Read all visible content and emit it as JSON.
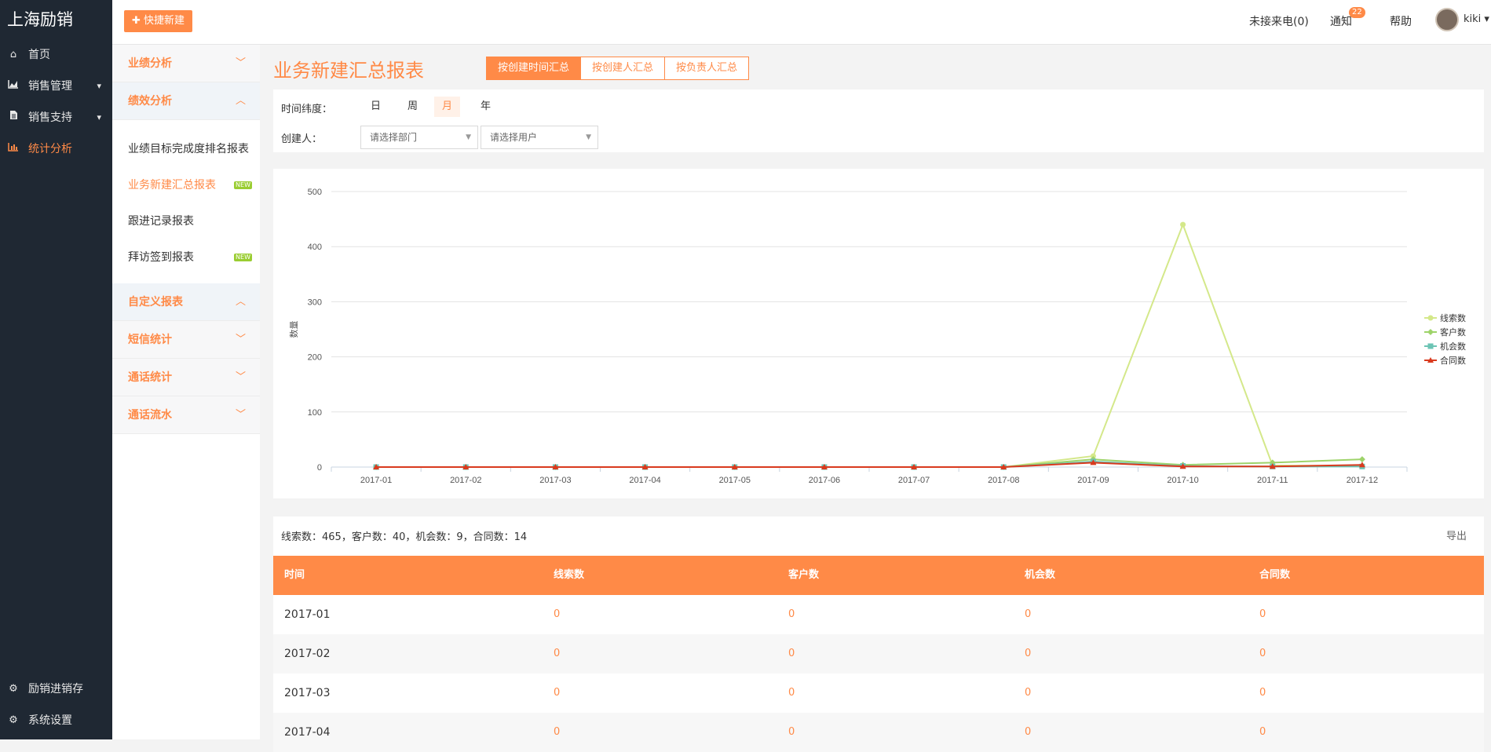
{
  "app": {
    "brand": "上海励销"
  },
  "topbar": {
    "quick_new": "✚ 快捷新建",
    "missed_calls": "未接来电(0)",
    "notice_label": "通知",
    "notice_count": "22",
    "help": "帮助",
    "user": "kiki ▾"
  },
  "left_nav": {
    "items": [
      {
        "icon": "home-icon",
        "label": "首页"
      },
      {
        "icon": "area-chart-icon",
        "label": "销售管理"
      },
      {
        "icon": "file-icon",
        "label": "销售支持"
      },
      {
        "icon": "bar-chart-icon",
        "label": "统计分析"
      }
    ],
    "bottom": [
      {
        "icon": "gear-icon",
        "label": "励销进销存"
      },
      {
        "icon": "gear-icon",
        "label": "系统设置"
      }
    ]
  },
  "sub_nav": {
    "groups": [
      {
        "label": "业绩分析",
        "open": false
      },
      {
        "label": "绩效分析",
        "open": true,
        "items": [
          {
            "label": "业绩目标完成度排名报表",
            "badge": ""
          },
          {
            "label": "业务新建汇总报表",
            "badge": "NEW"
          },
          {
            "label": "跟进记录报表",
            "badge": ""
          },
          {
            "label": "拜访签到报表",
            "badge": "NEW"
          }
        ]
      },
      {
        "label": "自定义报表",
        "open": true
      },
      {
        "label": "短信统计",
        "open": false
      },
      {
        "label": "通话统计",
        "open": false
      },
      {
        "label": "通话流水",
        "open": false
      }
    ]
  },
  "page": {
    "title": "业务新建汇总报表",
    "tabs": [
      "按创建时间汇总",
      "按创建人汇总",
      "按负责人汇总"
    ]
  },
  "filters": {
    "dimension_label": "时间纬度：",
    "dimensions": [
      "日",
      "周",
      "月",
      "年"
    ],
    "active_dimension": "月",
    "creator_label": "创建人：",
    "dept_placeholder": "请选择部门",
    "user_placeholder": "请选择用户"
  },
  "chart_data": {
    "type": "line",
    "ylabel": "数量",
    "ylim": [
      0,
      500
    ],
    "yticks": [
      0,
      100,
      200,
      300,
      400,
      500
    ],
    "categories": [
      "2017-01",
      "2017-02",
      "2017-03",
      "2017-04",
      "2017-05",
      "2017-06",
      "2017-07",
      "2017-08",
      "2017-09",
      "2017-10",
      "2017-11",
      "2017-12"
    ],
    "legend_position": "right",
    "series": [
      {
        "name": "线索数",
        "color": "#d4e88a",
        "marker": "circle",
        "values": [
          0,
          0,
          0,
          0,
          0,
          0,
          0,
          0,
          20,
          440,
          3,
          2
        ]
      },
      {
        "name": "客户数",
        "color": "#9ed36a",
        "marker": "diamond",
        "values": [
          0,
          0,
          0,
          0,
          0,
          0,
          0,
          0,
          14,
          4,
          8,
          14
        ]
      },
      {
        "name": "机会数",
        "color": "#6cc4b4",
        "marker": "square",
        "values": [
          0,
          0,
          0,
          0,
          0,
          0,
          0,
          0,
          10,
          2,
          1,
          1
        ]
      },
      {
        "name": "合同数",
        "color": "#d93a1e",
        "marker": "triangle",
        "values": [
          0,
          0,
          0,
          0,
          0,
          0,
          0,
          0,
          8,
          1,
          1,
          4
        ]
      }
    ]
  },
  "summary": {
    "text": "线索数：465，客户数：40，机会数：9，合同数：14",
    "export": "导出"
  },
  "table": {
    "headers": [
      "时间",
      "线索数",
      "客户数",
      "机会数",
      "合同数"
    ],
    "rows": [
      [
        "2017-01",
        "0",
        "0",
        "0",
        "0"
      ],
      [
        "2017-02",
        "0",
        "0",
        "0",
        "0"
      ],
      [
        "2017-03",
        "0",
        "0",
        "0",
        "0"
      ],
      [
        "2017-04",
        "0",
        "0",
        "0",
        "0"
      ]
    ]
  }
}
